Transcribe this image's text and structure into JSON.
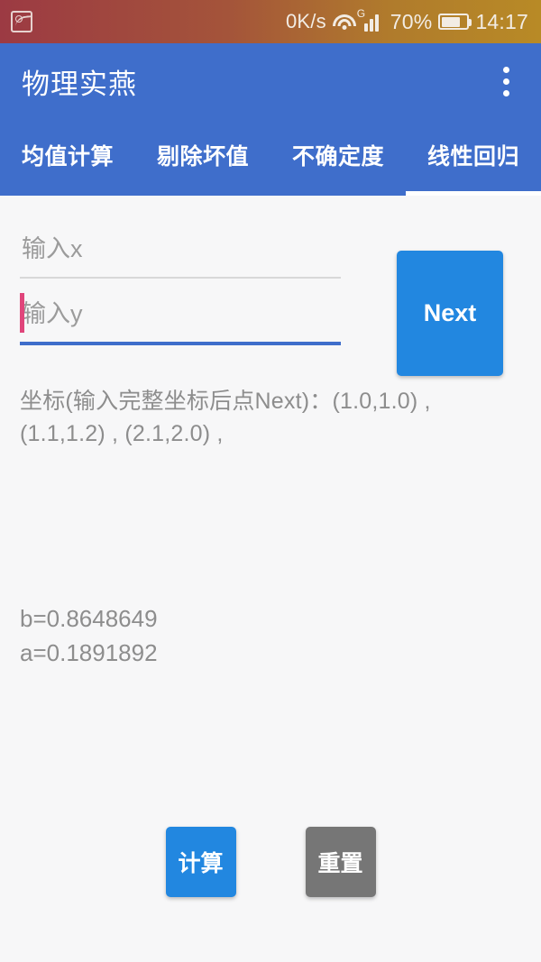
{
  "status_bar": {
    "notification_icon": "screenshot-image-icon",
    "network_speed": "0K/s",
    "wifi_icon": "wifi-icon",
    "network_type": "G",
    "signal_icon": "cellular-signal-icon",
    "battery_percent": "70%",
    "battery_icon": "battery-icon",
    "clock": "14:17",
    "gradient_start": "#9c3a43",
    "gradient_end": "#b88a26"
  },
  "app_bar": {
    "title": "物理实燕",
    "overflow_label": "overflow-menu",
    "background": "#3f6ecb"
  },
  "tabs": {
    "items": [
      {
        "label": "均值计算",
        "active": false
      },
      {
        "label": "剔除坏值",
        "active": false
      },
      {
        "label": "不确定度",
        "active": false
      },
      {
        "label": "线性回归",
        "active": true
      }
    ],
    "indicator_color": "#ffffff"
  },
  "form": {
    "x_input": {
      "value": "",
      "placeholder": "输入x",
      "focused": false
    },
    "y_input": {
      "value": "",
      "placeholder": "输入y",
      "focused": true,
      "caret_color": "#e0457b"
    },
    "next_button": {
      "label": "Next",
      "color": "#2287e0"
    }
  },
  "coordinates": {
    "text": "坐标(输入完整坐标后点Next)：(1.0,1.0) , (1.1,1.2) , (2.1,2.0) ,",
    "prompt": "坐标(输入完整坐标后点Next)：",
    "points": [
      "(1.0,1.0)",
      "(1.1,1.2)",
      "(2.1,2.0)"
    ]
  },
  "results": {
    "slope_line": "b=0.8648649",
    "intercept_line": "a=0.1891892",
    "b": 0.8648649,
    "a": 0.1891892
  },
  "actions": {
    "calculate": {
      "label": "计算",
      "color": "#2287e0"
    },
    "reset": {
      "label": "重置",
      "color": "#767676"
    }
  }
}
